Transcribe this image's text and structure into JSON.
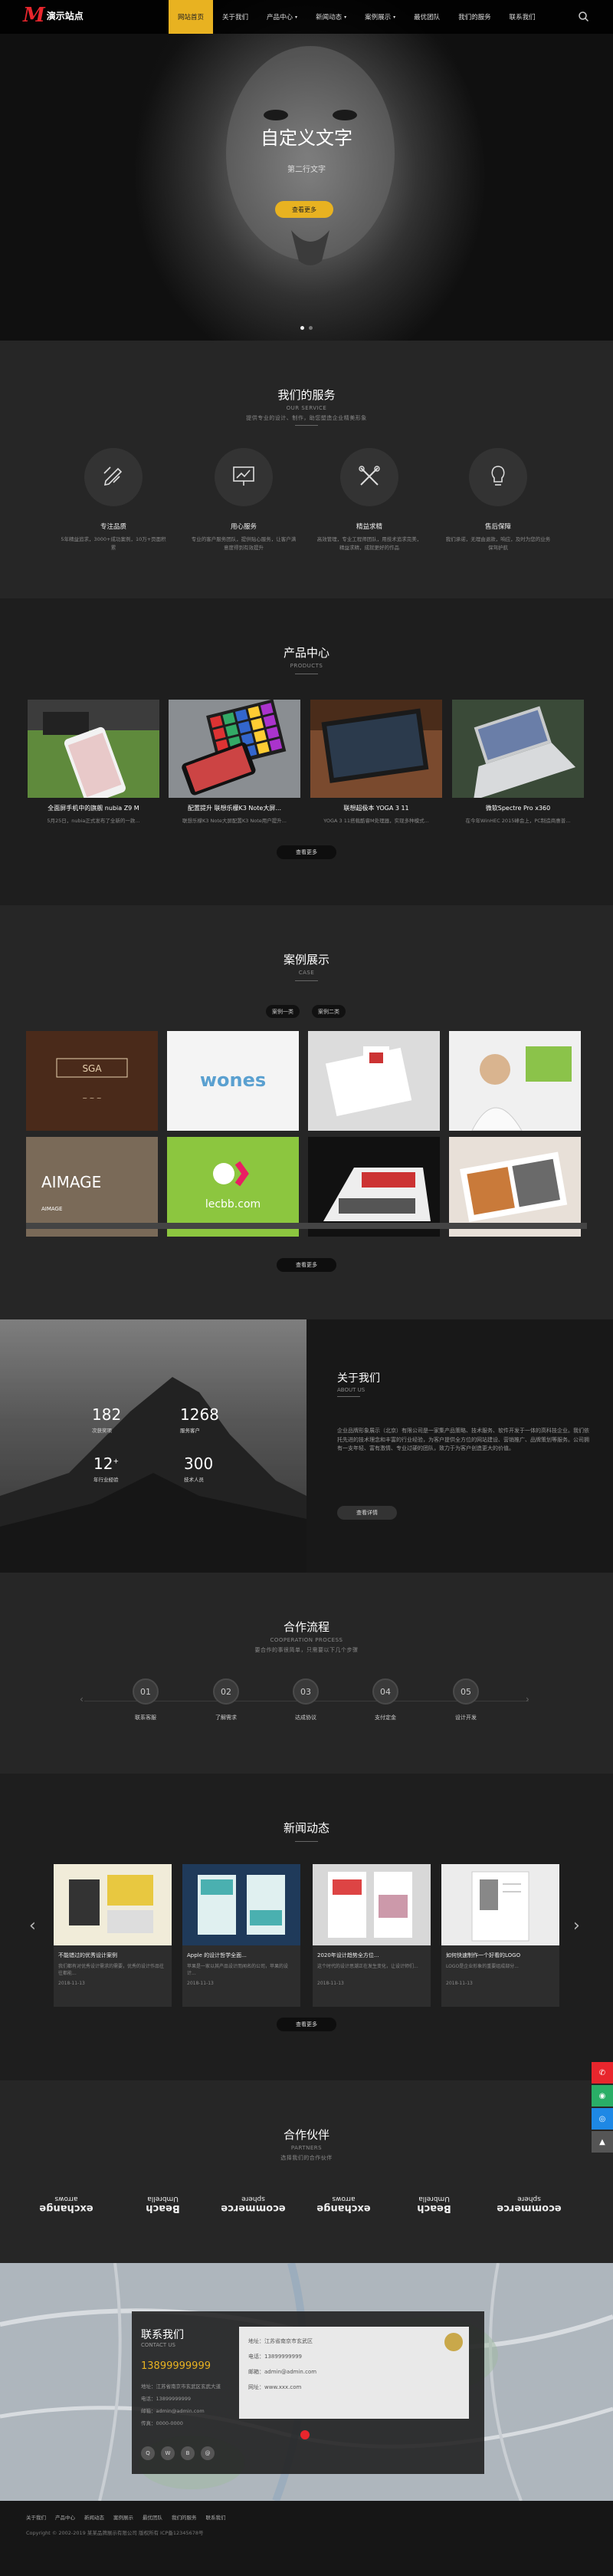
{
  "header": {
    "logo_mark": "M",
    "logo_text": "演示站点",
    "nav": [
      {
        "label": "网站首页",
        "active": true,
        "dropdown": false
      },
      {
        "label": "关于我们",
        "active": false,
        "dropdown": false
      },
      {
        "label": "产品中心",
        "active": false,
        "dropdown": true
      },
      {
        "label": "新闻动态",
        "active": false,
        "dropdown": true
      },
      {
        "label": "案例展示",
        "active": false,
        "dropdown": true
      },
      {
        "label": "最优团队",
        "active": false,
        "dropdown": false
      },
      {
        "label": "我们的服务",
        "active": false,
        "dropdown": false
      },
      {
        "label": "联系我们",
        "active": false,
        "dropdown": false
      }
    ],
    "search_icon": "search-icon",
    "accent_color": "#e8b221"
  },
  "hero": {
    "title": "自定义文字",
    "subtitle": "第二行文字",
    "button": "查看更多"
  },
  "services": {
    "title": "我们的服务",
    "subtitle": "OUR SERVICE",
    "intro": "提供专业的设计、制作，助您塑造企业精美形象",
    "items": [
      {
        "icon": "pencil-ruler-icon",
        "name": "专注品质",
        "desc": "5年精益追求，3000+成功案例，10万+页面积累"
      },
      {
        "icon": "presentation-icon",
        "name": "用心服务",
        "desc": "专业的客户服务团队，提供贴心服务，让客户满意度得到有效提升"
      },
      {
        "icon": "tools-icon",
        "name": "精益求精",
        "desc": "高效管理，专业工程师团队，用技术追求完美，精益求精，成就更好的作品"
      },
      {
        "icon": "lightbulb-icon",
        "name": "售后保障",
        "desc": "我们承诺，无理由退款，响应，及时为您的业务保驾护航"
      }
    ]
  },
  "products": {
    "title": "产品中心",
    "subtitle": "PRODUCTS",
    "button": "查看更多",
    "items": [
      {
        "name": "全面屏手机中的旗舰 nubia Z9 M",
        "desc": "5月25日，nubia正式发布了全新的一款..."
      },
      {
        "name": "配置提升 联想乐檬K3 Note大屏...",
        "desc": "联想乐檬K3 Note大屏配置K3 Note用户提升..."
      },
      {
        "name": "联想超极本 YOGA 3 11",
        "desc": "YOGA 3 11搭载酷睿M处理器，实现多种模式..."
      },
      {
        "name": "微软Spectre Pro x360",
        "desc": "在今年WinHEC 2015峰会上，PC制造商惠普..."
      }
    ]
  },
  "cases": {
    "title": "案例展示",
    "subtitle": "CASE",
    "tabs": [
      "案例一类",
      "案例二类"
    ],
    "button": "查看更多",
    "items": [
      {
        "label": "SGA"
      },
      {
        "label": "wones"
      },
      {
        "label": "brochure"
      },
      {
        "label": "teacher"
      },
      {
        "label": "AIMAGE"
      },
      {
        "label": "lecbb.com"
      },
      {
        "label": "exhibition booth"
      },
      {
        "label": "magazine"
      }
    ]
  },
  "about": {
    "title": "关于我们",
    "subtitle": "ABOUT US",
    "body": "企业品牌形象展示（北京）有限公司是一家集产品策略、技术服务、软件开发于一体的高科技企业。我们依托先进的技术理念和丰富的行业经验，为客户提供全方位的网站建设、营销推广、品牌策划等服务。公司拥有一支年轻、富有激情、专业过硬的团队，致力于为客户创造更大的价值。",
    "button": "查看详情",
    "stats": [
      {
        "num": "182",
        "label": "次获奖项"
      },
      {
        "num": "1268",
        "label": "服务客户"
      },
      {
        "num": "12",
        "sup": "+",
        "label": "年行业经验"
      },
      {
        "num": "300",
        "label": "技术人员"
      }
    ]
  },
  "process": {
    "title": "合作流程",
    "subtitle": "COOPERATION PROCESS",
    "intro": "要合作的事很简单，只需要以下几个步骤",
    "steps": [
      {
        "num": "01",
        "label": "联系客服"
      },
      {
        "num": "02",
        "label": "了解需求"
      },
      {
        "num": "03",
        "label": "达成协议"
      },
      {
        "num": "04",
        "label": "支付定金"
      },
      {
        "num": "05",
        "label": "设计开发"
      }
    ]
  },
  "news": {
    "title": "新闻动态",
    "subtitle": "NEWS",
    "button": "查看更多",
    "items": [
      {
        "title": "不能错过的优秀设计案例",
        "desc": "我们都有对优秀设计需求的需要，优秀的设计作品往往都能...",
        "date": "2018-11-13"
      },
      {
        "title": "Apple 的设计哲学全面...",
        "desc": "苹果是一家以其产品设计而闻名的公司，苹果的设计...",
        "date": "2018-11-13"
      },
      {
        "title": "2020年设计趋势全方位...",
        "desc": "这个时代的设计思潮正在发生变化，让设计师们...",
        "date": "2018-11-13"
      },
      {
        "title": "如何快速制作一个好看的LOGO",
        "desc": "LOGO是企业形象的重要组成部分...",
        "date": "2018-11-13"
      }
    ]
  },
  "partners": {
    "title": "合作伙伴",
    "subtitle": "PARTNERS",
    "intro": "选择我们的合作伙伴",
    "logos": [
      {
        "top": "exchange",
        "bottom": "arrows"
      },
      {
        "top": "Beach",
        "bottom": "Umbrella"
      },
      {
        "top": "ecommerce",
        "bottom": "sphere"
      },
      {
        "top": "exchange",
        "bottom": "arrows"
      },
      {
        "top": "Beach",
        "bottom": "Umbrella"
      },
      {
        "top": "ecommerce",
        "bottom": "sphere"
      }
    ]
  },
  "contact": {
    "title": "联系我们",
    "subtitle": "CONTACT US",
    "phone": "13899999999",
    "lines": [
      "地址：江苏省南京市玄武区玄武大道",
      "电话：13899999999",
      "邮箱：admin@admin.com",
      "传真：0000-0000"
    ],
    "form_lines": [
      "地址：江苏省南京市玄武区",
      "电话：13899999999",
      "邮箱：admin@admin.com",
      "网址：www.xxx.com"
    ]
  },
  "footer": {
    "nav": [
      "关于我们",
      "产品中心",
      "新闻动态",
      "案例展示",
      "最优团队",
      "我们的服务",
      "联系我们"
    ],
    "copyright": "Copyright © 2002-2019 某某品牌展示有限公司 版权所有  ICP备12345678号"
  },
  "sidebar": [
    {
      "icon": "phone-icon",
      "color": "#e8262d"
    },
    {
      "icon": "wechat-icon",
      "color": "#2aae67"
    },
    {
      "icon": "qq-icon",
      "color": "#1e88e5"
    },
    {
      "icon": "arrow-up-icon",
      "color": "#555555"
    }
  ]
}
